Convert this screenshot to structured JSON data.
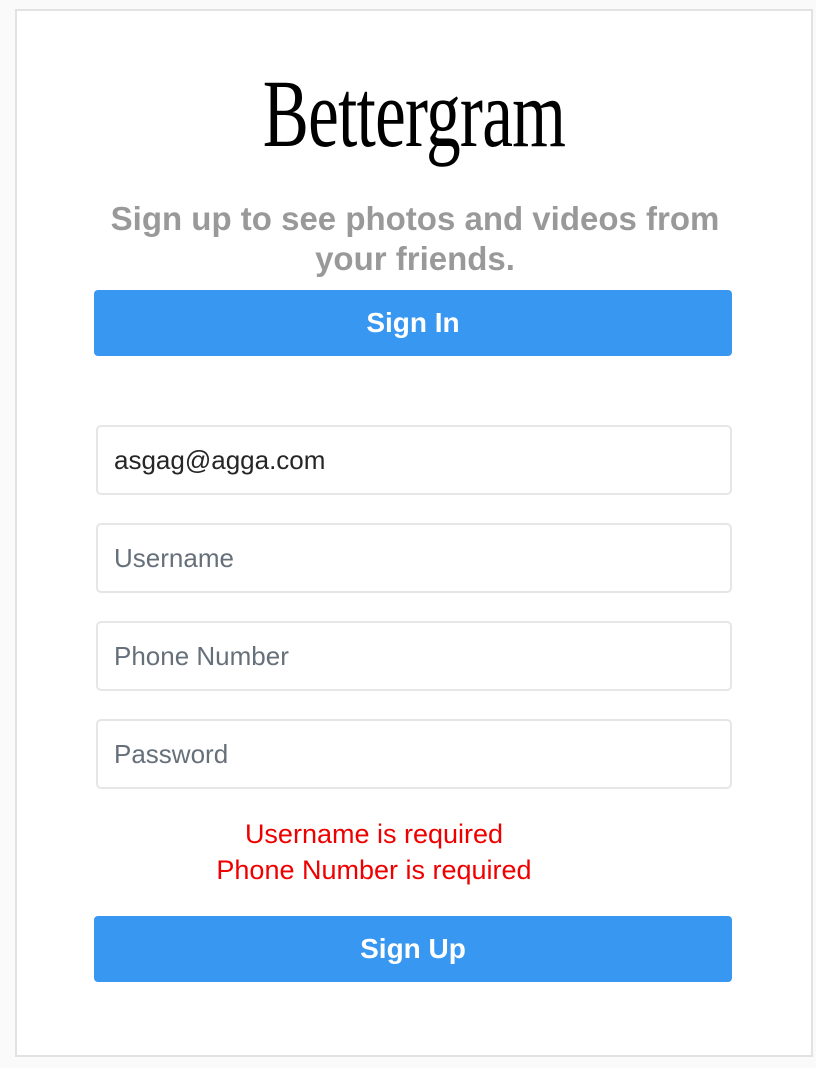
{
  "app": {
    "logo_text": "Bettergram",
    "tagline": "Sign up to see photos and videos from your friends."
  },
  "signin_button": {
    "label": "Sign In"
  },
  "form": {
    "email": {
      "value": "asgag@agga.com",
      "placeholder": ""
    },
    "username": {
      "value": "",
      "placeholder": "Username"
    },
    "phone": {
      "value": "",
      "placeholder": "Phone Number"
    },
    "password": {
      "value": "",
      "placeholder": "Password"
    }
  },
  "errors": [
    "Username is required",
    "Phone Number is required"
  ],
  "signup_button": {
    "label": "Sign Up"
  },
  "colors": {
    "accent": "#3897f0",
    "error": "#ee0000",
    "tagline": "#999999",
    "border": "#e6e6e6"
  }
}
